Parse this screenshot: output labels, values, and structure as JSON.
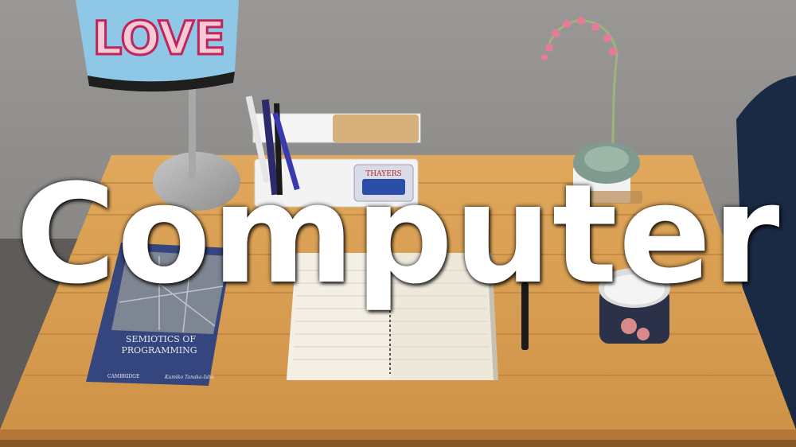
{
  "overlay_word": "Computer",
  "lamp_shade_text": "LOVE",
  "book": {
    "title_line1": "SEMIOTICS OF",
    "title_line2": "PROGRAMMING",
    "author": "Kumiko Tanaka-Ishii",
    "publisher": "CAMBRIDGE"
  },
  "tin": {
    "brand": "THAYERS"
  },
  "colors": {
    "wall": "#8e8c8a",
    "desk": "#d9a055",
    "book_cover": "#35467e",
    "notebook": "#f1ece0",
    "mug": "#2b3148"
  }
}
